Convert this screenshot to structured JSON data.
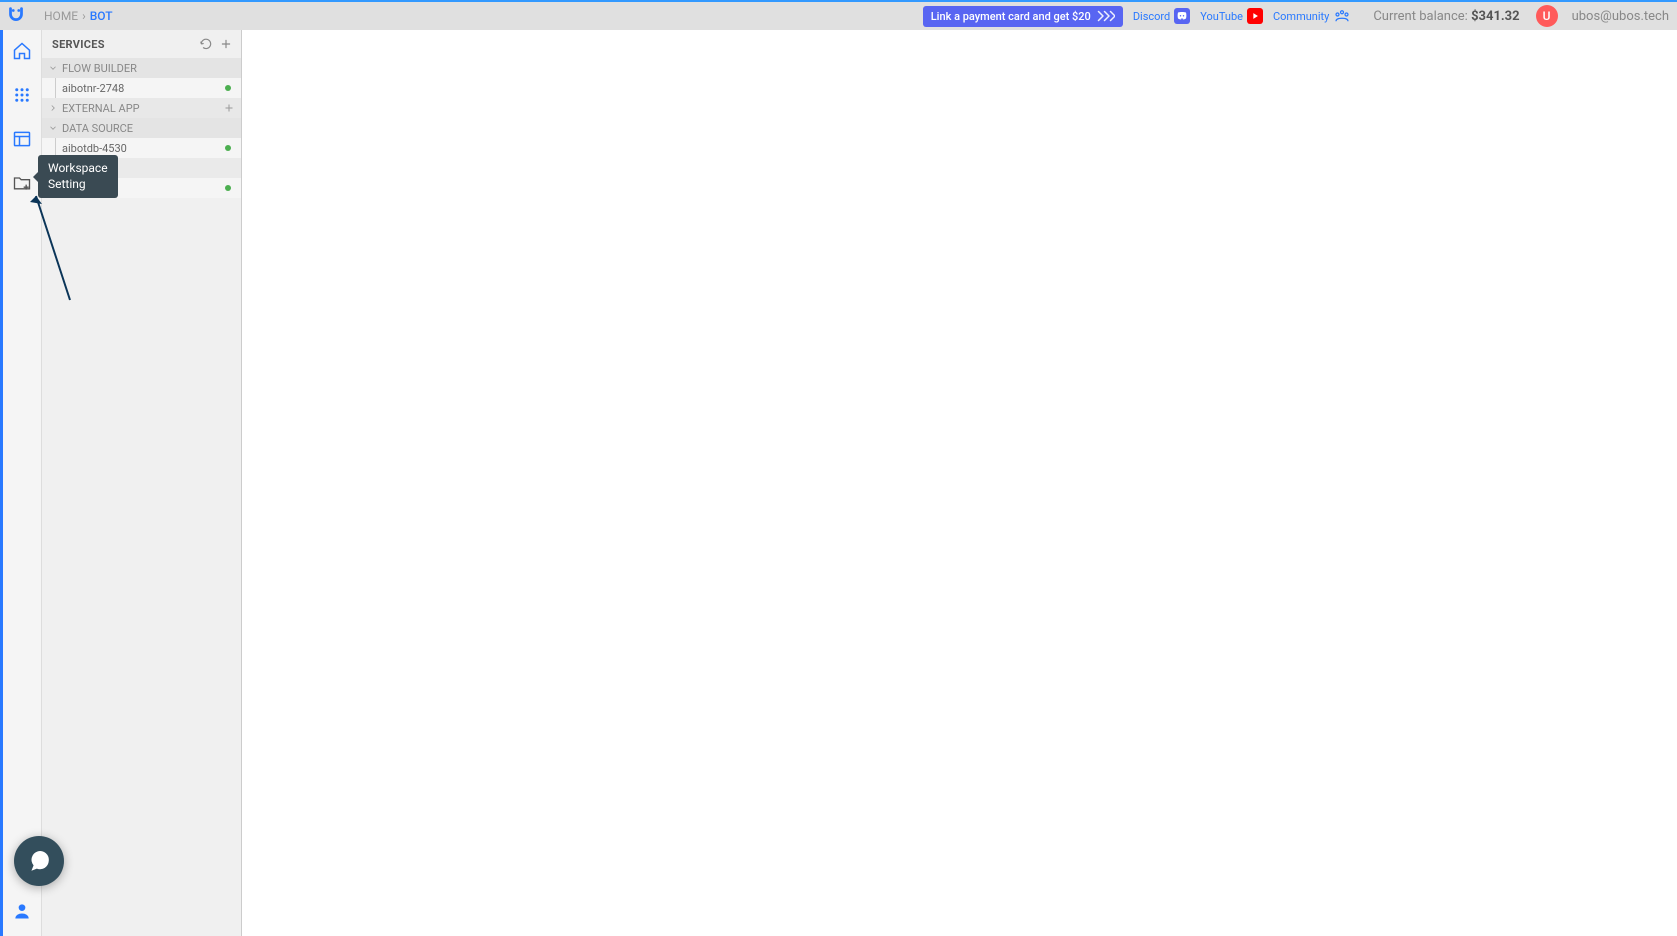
{
  "breadcrumb": {
    "home": "HOME",
    "current": "BOT"
  },
  "topbar": {
    "link_card_label": "Link a payment card and get $20",
    "discord": "Discord",
    "youtube": "YouTube",
    "community": "Community",
    "balance_label": "Current balance: ",
    "balance_value": "$341.32",
    "avatar_letter": "U",
    "user_email": "ubos@ubos.tech"
  },
  "sidebar": {
    "header": "SERVICES",
    "groups": [
      {
        "label": "FLOW BUILDER",
        "expanded": true,
        "items": [
          {
            "name": "aibotnr-2748",
            "status": "online"
          }
        ]
      },
      {
        "label": "EXTERNAL APP",
        "expanded": false,
        "has_add": true,
        "items": []
      },
      {
        "label": "DATA SOURCE",
        "expanded": true,
        "items": [
          {
            "name": "aibotdb-4530",
            "status": "online"
          }
        ]
      }
    ]
  },
  "tooltip": {
    "line1": "Workspace",
    "line2": "Setting"
  },
  "rail_icons": {
    "home": "home",
    "apps": "apps",
    "layout": "layout",
    "folder_add": "folder-add",
    "user": "user"
  }
}
